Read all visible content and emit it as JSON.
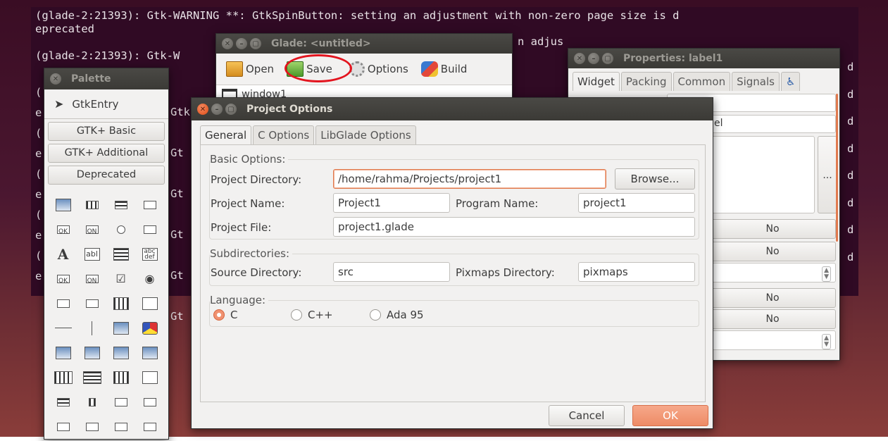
{
  "terminal": {
    "lines": [
      "(glade-2:21393): Gtk-WARNING **: GtkSpinButton: setting an adjustment with non-zero page size is d",
      "eprecated",
      "",
      "(glade-2:21393): Gtk-W",
      "e"
    ],
    "right_fragment": "n adjus",
    "left_fragments": [
      "(",
      "e",
      "(",
      "e",
      "(",
      "e",
      "(",
      "e",
      "(",
      "e",
      "("
    ],
    "right_letters": [
      "d",
      "d",
      "d",
      "d",
      "d",
      "d",
      "d",
      "d"
    ],
    "mid_fragments": [
      "Gtk",
      "Gt",
      "Gt",
      "Gt",
      "Gt",
      "Gt"
    ]
  },
  "palette": {
    "title": "Palette",
    "selector": "GtkEntry",
    "groups": [
      "GTK+ Basic",
      "GTK+ Additional",
      "Deprecated"
    ]
  },
  "glade": {
    "title": "Glade: <untitled>",
    "toolbar": {
      "open": "Open",
      "save": "Save",
      "options": "Options",
      "build": "Build"
    },
    "tree_item": "window1"
  },
  "properties": {
    "title": "Properties: label1",
    "tabs": [
      "Widget",
      "Packing",
      "Common",
      "Signals"
    ],
    "field_fragment": "el",
    "toggle_values": [
      "No",
      "No",
      "No",
      "No"
    ],
    "ellipsis": "..."
  },
  "dialog": {
    "title": "Project Options",
    "tabs": [
      "General",
      "C Options",
      "LibGlade Options"
    ],
    "basic": {
      "title": "Basic Options:",
      "project_directory_label": "Project Directory:",
      "project_directory": "/home/rahma/Projects/project1",
      "browse": "Browse...",
      "project_name_label": "Project Name:",
      "project_name": "Project1",
      "program_name_label": "Program Name:",
      "program_name": "project1",
      "project_file_label": "Project File:",
      "project_file": "project1.glade"
    },
    "subdirs": {
      "title": "Subdirectories:",
      "source_label": "Source Directory:",
      "source": "src",
      "pixmaps_label": "Pixmaps Directory:",
      "pixmaps": "pixmaps"
    },
    "language": {
      "title": "Language:",
      "options": [
        "C",
        "C++",
        "Ada 95"
      ],
      "selected": "C"
    },
    "cancel": "Cancel",
    "ok": "OK"
  },
  "colors": {
    "terminal_bg": "#300a24",
    "accent_orange": "#ee8c66",
    "highlight_circle": "#e3141e"
  }
}
